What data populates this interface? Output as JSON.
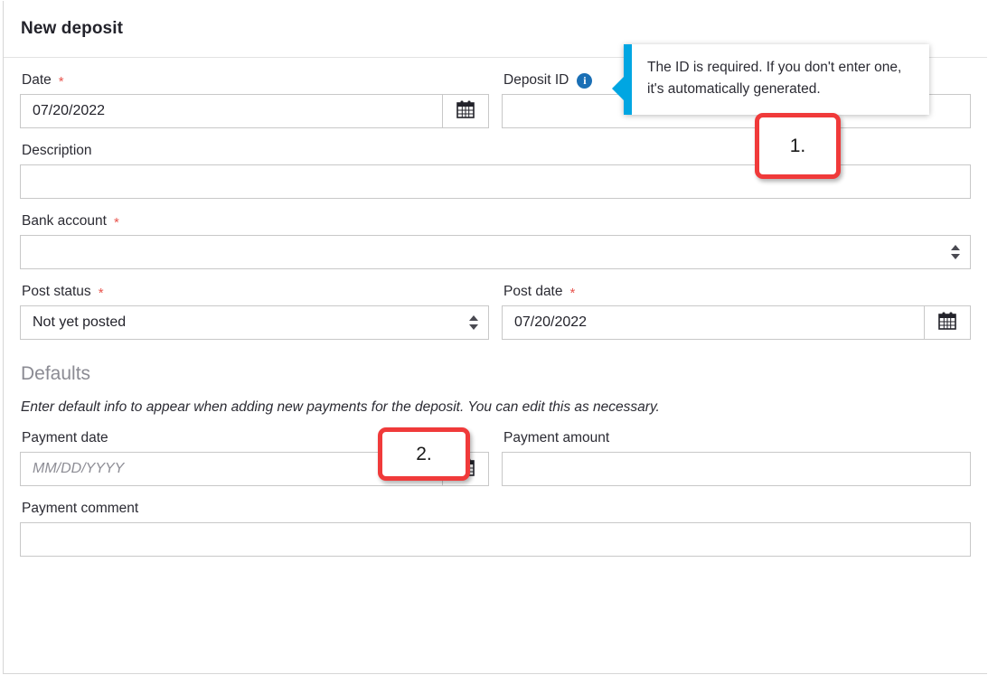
{
  "header": {
    "title": "New deposit"
  },
  "form": {
    "date": {
      "label": "Date",
      "required": "*",
      "value": "07/20/2022",
      "calendar_icon": "calendar-icon"
    },
    "deposit_id": {
      "label": "Deposit ID",
      "info_icon": "info-icon",
      "info_glyph": "i",
      "value": ""
    },
    "description": {
      "label": "Description",
      "value": ""
    },
    "bank_account": {
      "label": "Bank account",
      "required": "*",
      "value": ""
    },
    "post_status": {
      "label": "Post status",
      "required": "*",
      "value": "Not yet posted"
    },
    "post_date": {
      "label": "Post date",
      "required": "*",
      "value": "07/20/2022",
      "calendar_icon": "calendar-icon"
    }
  },
  "defaults": {
    "section_title": "Defaults",
    "section_description": "Enter default info to appear when adding new payments for the deposit. You can edit this as necessary.",
    "payment_date": {
      "label": "Payment date",
      "value": "",
      "placeholder": "MM/DD/YYYY",
      "calendar_icon": "calendar-icon"
    },
    "payment_amount": {
      "label": "Payment amount",
      "value": ""
    },
    "payment_comment": {
      "label": "Payment comment",
      "value": ""
    }
  },
  "tooltip": {
    "text": "The ID is required. If you don't enter one, it's automatically generated."
  },
  "callouts": [
    {
      "label": "1."
    },
    {
      "label": "2."
    }
  ],
  "colors": {
    "tooltip_accent": "#00a6e2",
    "callout_border": "#f03a3a",
    "required_marker": "#e8554e",
    "info_icon_bg": "#1a6fb5"
  }
}
